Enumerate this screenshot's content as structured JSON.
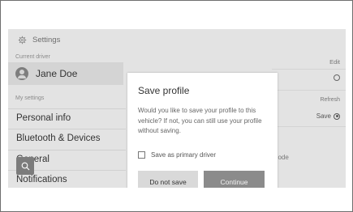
{
  "settings": {
    "title": "Settings",
    "current_driver_label": "Current driver",
    "driver_name": "Jane Doe",
    "my_settings_label": "My settings",
    "menu": [
      "Personal info",
      "Bluetooth & Devices",
      "General",
      "Notifications"
    ]
  },
  "right_panel": {
    "edit": "Edit",
    "refresh": "Refresh",
    "save": "Save",
    "mode_fragment": "node"
  },
  "dialog": {
    "title": "Save profile",
    "message": "Would you like to save your profile to this vehicle? If not, you can still use your profile without saving.",
    "checkbox_label": "Save as primary driver",
    "buttons": {
      "do_not_save": "Do not save",
      "continue": "Continue"
    }
  },
  "icons": {
    "gear": "gear-icon",
    "avatar": "avatar",
    "search": "search-icon"
  },
  "colors": {
    "screen_bg": "#e3e3e3",
    "dialog_bg": "#ffffff",
    "continue_button": "#8b8b8b",
    "do_not_save_button": "#d9d9d9"
  }
}
